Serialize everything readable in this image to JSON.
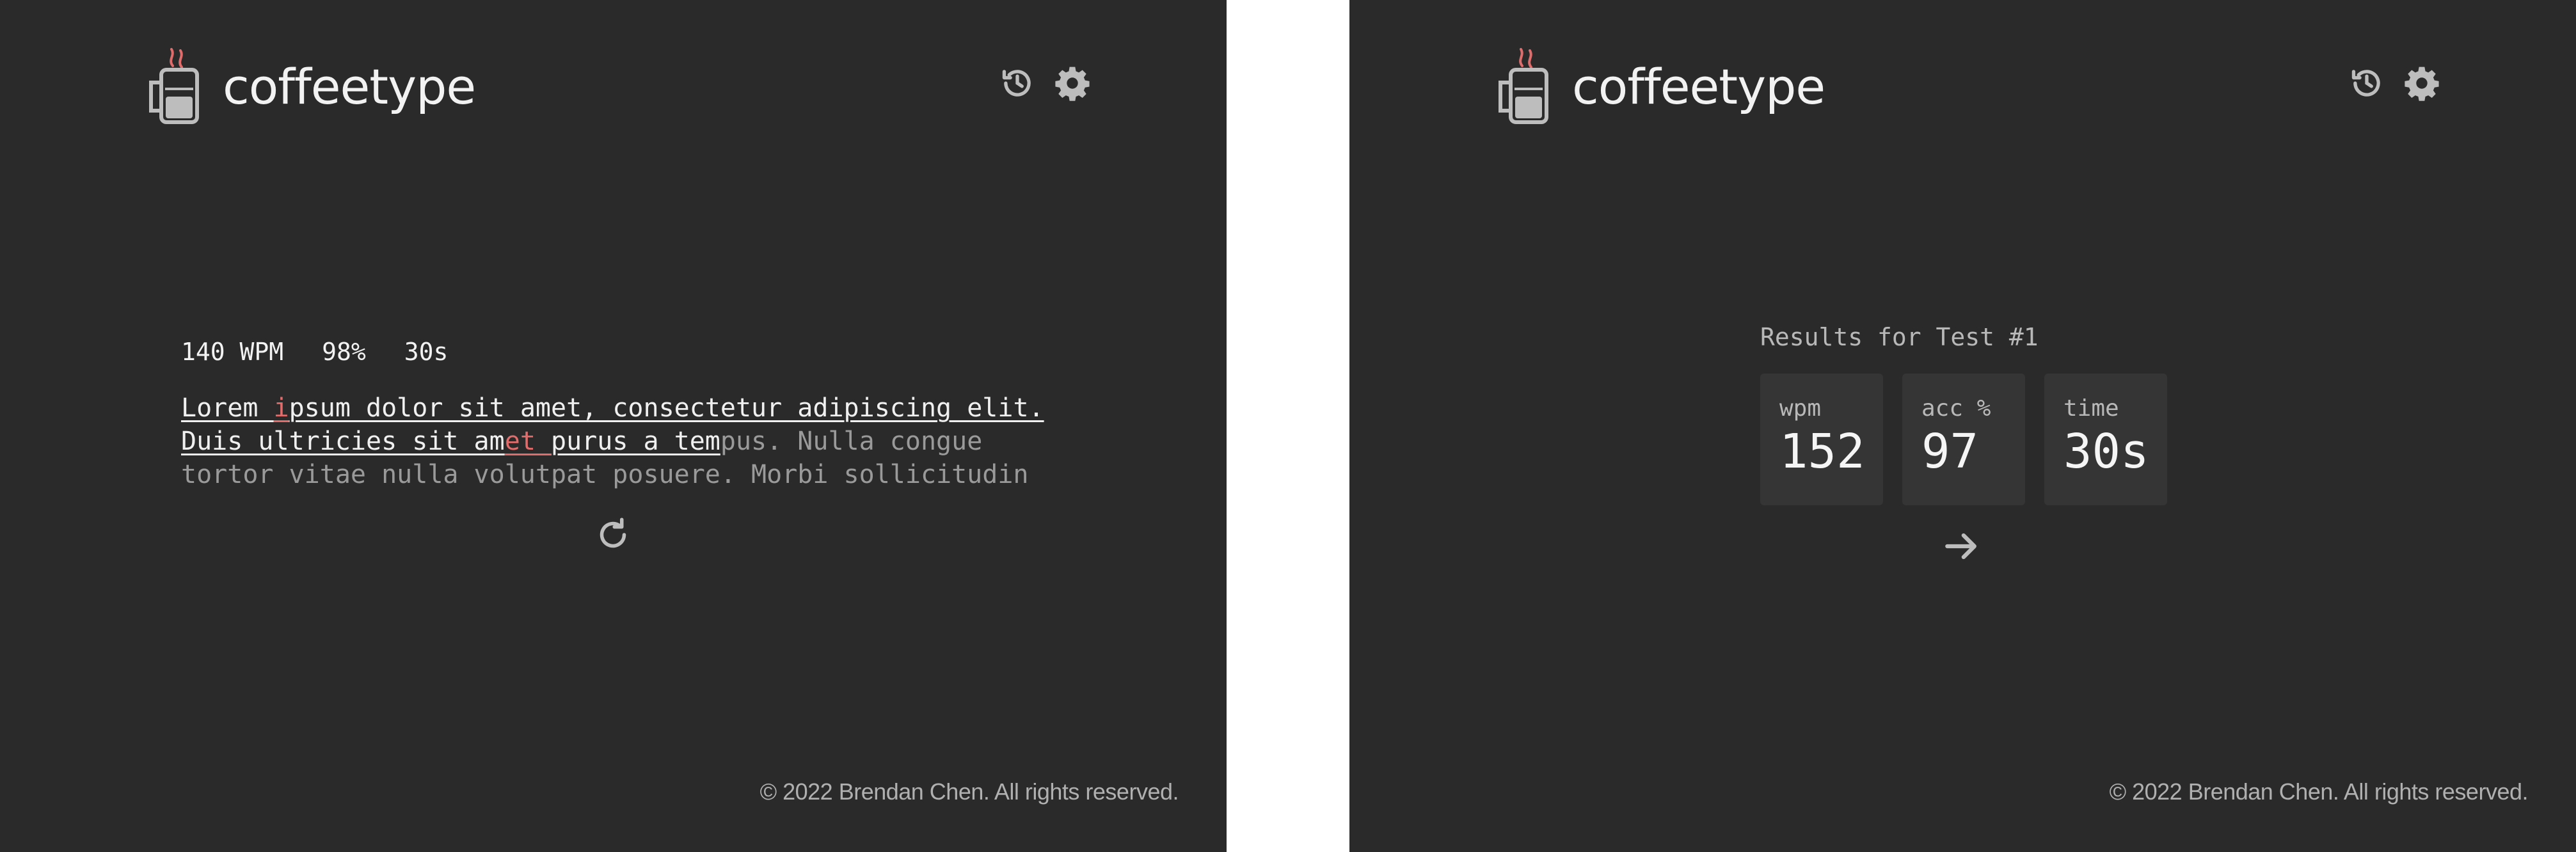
{
  "app": {
    "brand_name": "coffeetype"
  },
  "colors": {
    "background": "#2a2a2a",
    "text": "#f2f2f2",
    "muted": "#9a9a9a",
    "error": "#e06c6c",
    "card": "#353535"
  },
  "icons": {
    "logo": "coffee-mug-icon",
    "history": "history-icon",
    "settings": "gear-icon",
    "restart": "restart-icon",
    "next": "arrow-right-icon"
  },
  "test_screen": {
    "stats": {
      "wpm": "140 WPM",
      "accuracy": "98%",
      "time": "30s"
    },
    "text": {
      "line1": {
        "typed_a": "Lorem ",
        "error_a": "i",
        "typed_b": "psum dolor sit amet, consectetur adipiscing elit."
      },
      "line2": {
        "typed_a": "Duis ultricies sit am",
        "error_a": "et ",
        "typed_b": "purus a tem",
        "untyped": "pus. Nulla congue"
      },
      "line3": {
        "untyped": "tortor vitae nulla volutpat posuere. Morbi sollicitudin"
      }
    }
  },
  "results_screen": {
    "title": "Results for Test #1",
    "cards": [
      {
        "label": "wpm",
        "value": "152"
      },
      {
        "label": "acc %",
        "value": "97"
      },
      {
        "label": "time",
        "value": "30s"
      }
    ]
  },
  "footer": {
    "text": "© 2022 Brendan Chen. All rights reserved."
  }
}
